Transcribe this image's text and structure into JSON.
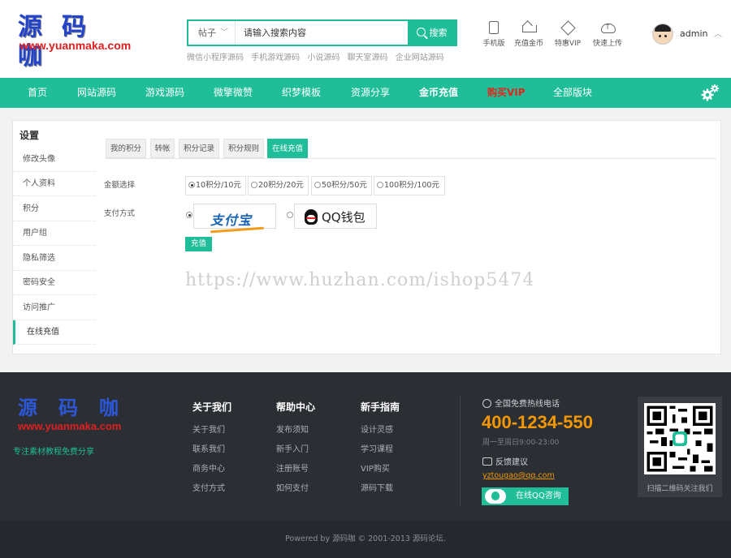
{
  "header": {
    "logo_cn": "源码咖",
    "logo_en": "www.yuanmaka.com",
    "search": {
      "type": "帖子",
      "placeholder": "请输入搜索内容",
      "button": "搜索"
    },
    "hot_links": [
      "微信小程序源码",
      "手机游戏源码",
      "小说源码",
      "聊天室源码",
      "企业网站源码"
    ],
    "quick_links": [
      {
        "label": "手机版",
        "icon": "phone-icon"
      },
      {
        "label": "充值金币",
        "icon": "crown-icon"
      },
      {
        "label": "特惠VIP",
        "icon": "diamond-icon"
      },
      {
        "label": "快速上传",
        "icon": "upload-cloud-icon"
      }
    ],
    "user": {
      "name": "admin"
    }
  },
  "nav": {
    "items": [
      "首页",
      "网站源码",
      "游戏源码",
      "微擎微赞",
      "织梦模板",
      "资源分享",
      "金币充值",
      "购买VIP",
      "全部版块"
    ],
    "accent": "#1fbe98",
    "vip_color": "#e8231d"
  },
  "sidebar": {
    "title": "设置",
    "items": [
      "修改头像",
      "个人资料",
      "积分",
      "用户组",
      "隐私筛选",
      "密码安全",
      "访问推广",
      "在线充值"
    ],
    "active_index": 7
  },
  "content": {
    "tabs": [
      "我的积分",
      "转帐",
      "积分记录",
      "积分规则",
      "在线充值"
    ],
    "active_tab": 4,
    "amount_label": "金额选择",
    "amounts": [
      "10积分/10元",
      "20积分/20元",
      "50积分/50元",
      "100积分/100元"
    ],
    "amount_selected": 0,
    "payment_label": "支付方式",
    "payments": [
      "支付宝",
      "QQ钱包"
    ],
    "payment_selected": 0,
    "submit": "充值"
  },
  "watermark": "https://www.huzhan.com/ishop5474",
  "footer": {
    "logo_cn": "源码咖",
    "logo_en": "www.yuanmaka.com",
    "slogan": "专注素材教程免费分享",
    "columns": [
      {
        "title": "关于我们",
        "links": [
          "关于我们",
          "联系我们",
          "商务中心",
          "支付方式"
        ]
      },
      {
        "title": "帮助中心",
        "links": [
          "发布须知",
          "新手入门",
          "注册账号",
          "如何支付"
        ]
      },
      {
        "title": "新手指南",
        "links": [
          "设计灵感",
          "学习课程",
          "VIP购买",
          "源码下载"
        ]
      }
    ],
    "hotline_label": "全国免费热线电话",
    "phone": "400-1234-550",
    "hours": "周一至周日9:00-23:00",
    "feedback_label": "反馈建议",
    "email": "yztougao@qq.com",
    "qq_button": "在线QQ咨询",
    "qr_caption": "扫描二维码关注我们",
    "copyright": "Powered by 源码咖 © 2001-2013 源码论坛."
  }
}
